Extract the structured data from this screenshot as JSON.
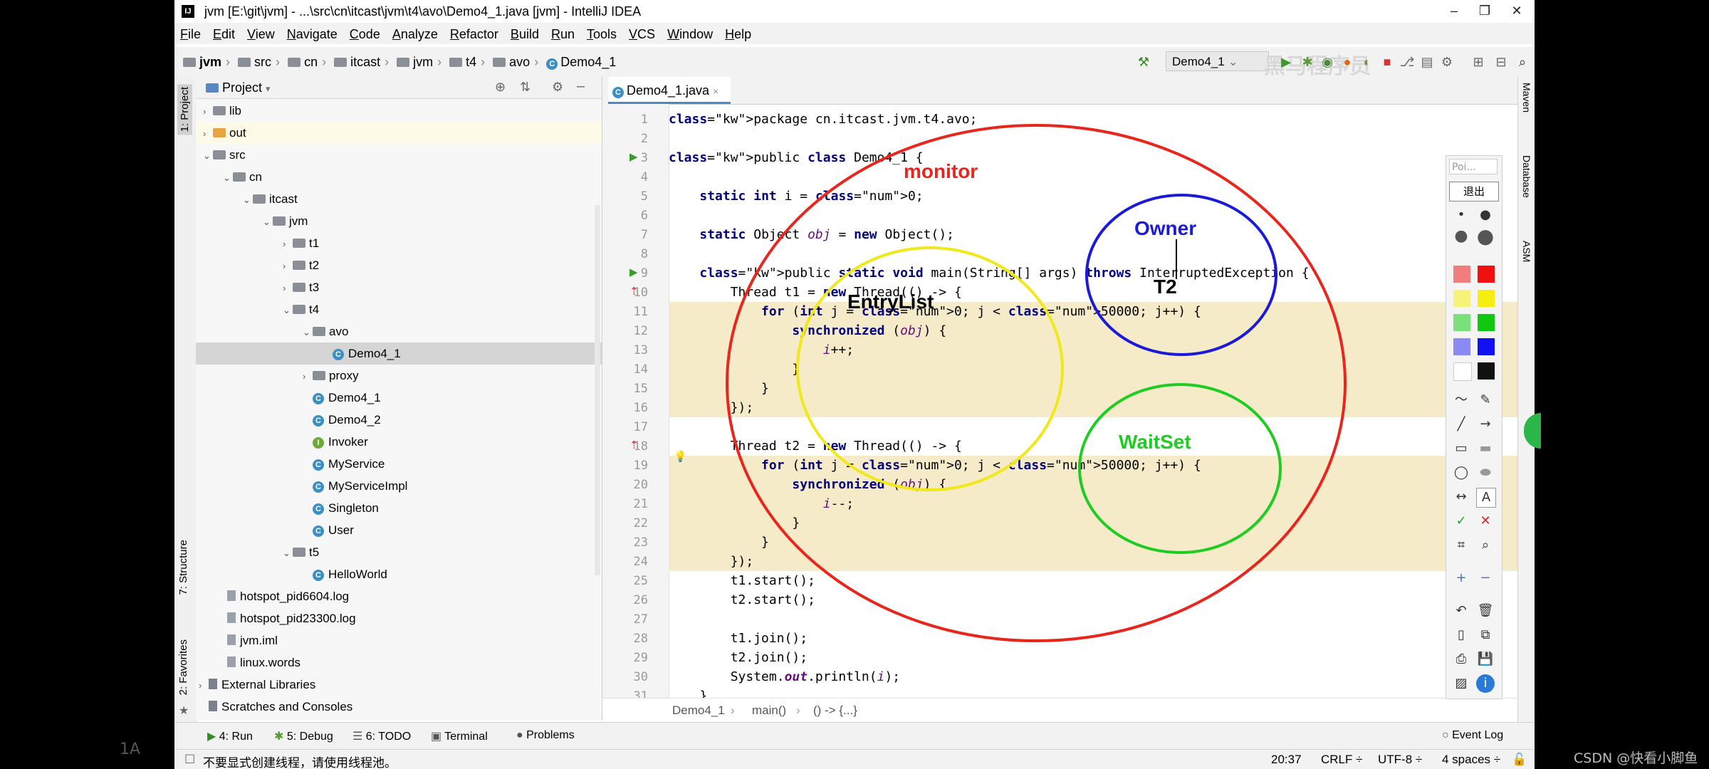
{
  "window": {
    "title": "jvm [E:\\git\\jvm] - ...\\src\\cn\\itcast\\jvm\\t4\\avo\\Demo4_1.java [jvm] - IntelliJ IDEA",
    "minimize": "–",
    "maximize": "❐",
    "close": "✕"
  },
  "menu": [
    "File",
    "Edit",
    "View",
    "Navigate",
    "Code",
    "Analyze",
    "Refactor",
    "Build",
    "Run",
    "Tools",
    "VCS",
    "Window",
    "Help"
  ],
  "breadcrumb": [
    "jvm",
    "src",
    "cn",
    "itcast",
    "jvm",
    "t4",
    "avo",
    "Demo4_1"
  ],
  "run_config": "Demo4_1",
  "toolbar_overlay_text": "黑马程序员",
  "left_strip": {
    "project": "1: Project",
    "structure": "7: Structure",
    "favorites": "2: Favorites"
  },
  "project_panel": {
    "title": "Project",
    "tree": [
      {
        "label": "lib",
        "type": "folder",
        "depth": 0,
        "arrow": "›"
      },
      {
        "label": "out",
        "type": "folder-orange",
        "depth": 0,
        "arrow": "›"
      },
      {
        "label": "src",
        "type": "folder",
        "depth": 0,
        "arrow": "⌄"
      },
      {
        "label": "cn",
        "type": "folder",
        "depth": 1,
        "arrow": "⌄"
      },
      {
        "label": "itcast",
        "type": "folder",
        "depth": 2,
        "arrow": "⌄"
      },
      {
        "label": "jvm",
        "type": "folder",
        "depth": 3,
        "arrow": "⌄"
      },
      {
        "label": "t1",
        "type": "folder",
        "depth": 4,
        "arrow": "›"
      },
      {
        "label": "t2",
        "type": "folder",
        "depth": 4,
        "arrow": "›"
      },
      {
        "label": "t3",
        "type": "folder",
        "depth": 4,
        "arrow": "›"
      },
      {
        "label": "t4",
        "type": "folder",
        "depth": 4,
        "arrow": "⌄"
      },
      {
        "label": "avo",
        "type": "folder",
        "depth": 5,
        "arrow": "⌄"
      },
      {
        "label": "Demo4_1",
        "type": "class",
        "depth": 6,
        "arrow": ""
      },
      {
        "label": "proxy",
        "type": "folder",
        "depth": 5,
        "arrow": "›"
      },
      {
        "label": "Demo4_1",
        "type": "class",
        "depth": 5,
        "arrow": ""
      },
      {
        "label": "Demo4_2",
        "type": "class",
        "depth": 5,
        "arrow": ""
      },
      {
        "label": "Invoker",
        "type": "interface",
        "depth": 5,
        "arrow": ""
      },
      {
        "label": "MyService",
        "type": "class",
        "depth": 5,
        "arrow": ""
      },
      {
        "label": "MyServiceImpl",
        "type": "class",
        "depth": 5,
        "arrow": ""
      },
      {
        "label": "Singleton",
        "type": "class",
        "depth": 5,
        "arrow": ""
      },
      {
        "label": "User",
        "type": "class",
        "depth": 5,
        "arrow": ""
      },
      {
        "label": "t5",
        "type": "folder",
        "depth": 4,
        "arrow": "⌄"
      },
      {
        "label": "HelloWorld",
        "type": "class",
        "depth": 5,
        "arrow": ""
      },
      {
        "label": "hotspot_pid6604.log",
        "type": "file",
        "depth": 0,
        "arrow": ""
      },
      {
        "label": "hotspot_pid23300.log",
        "type": "file",
        "depth": 0,
        "arrow": ""
      },
      {
        "label": "jvm.iml",
        "type": "file",
        "depth": 0,
        "arrow": ""
      },
      {
        "label": "linux.words",
        "type": "file",
        "depth": 0,
        "arrow": ""
      },
      {
        "label": "External Libraries",
        "type": "lib",
        "depth": -1,
        "arrow": "›"
      },
      {
        "label": "Scratches and Consoles",
        "type": "lib",
        "depth": -1,
        "arrow": ""
      }
    ]
  },
  "editor": {
    "tab": "Demo4_1.java",
    "lines": [
      {
        "n": "1",
        "t": "package cn.itcast.jvm.t4.avo;"
      },
      {
        "n": "2",
        "t": ""
      },
      {
        "n": "3",
        "t": "public class Demo4_1 {"
      },
      {
        "n": "4",
        "t": ""
      },
      {
        "n": "5",
        "t": "    static int i = 0;"
      },
      {
        "n": "6",
        "t": ""
      },
      {
        "n": "7",
        "t": "    static Object obj = new Object();"
      },
      {
        "n": "8",
        "t": ""
      },
      {
        "n": "9",
        "t": "    public static void main(String[] args) throws InterruptedException {"
      },
      {
        "n": "10",
        "t": "        Thread t1 = new Thread(() -> {"
      },
      {
        "n": "11",
        "t": "            for (int j = 0; j < 50000; j++) {"
      },
      {
        "n": "12",
        "t": "                synchronized (obj) {"
      },
      {
        "n": "13",
        "t": "                    i++;"
      },
      {
        "n": "14",
        "t": "                }"
      },
      {
        "n": "15",
        "t": "            }"
      },
      {
        "n": "16",
        "t": "        });"
      },
      {
        "n": "17",
        "t": ""
      },
      {
        "n": "18",
        "t": "        Thread t2 = new Thread(() -> {"
      },
      {
        "n": "19",
        "t": "            for (int j = 0; j < 50000; j++) {"
      },
      {
        "n": "20",
        "t": "                synchronized (obj) {"
      },
      {
        "n": "21",
        "t": "                    i--;"
      },
      {
        "n": "22",
        "t": "                }"
      },
      {
        "n": "23",
        "t": "            }"
      },
      {
        "n": "24",
        "t": "        });"
      },
      {
        "n": "25",
        "t": "        t1.start();"
      },
      {
        "n": "26",
        "t": "        t2.start();"
      },
      {
        "n": "27",
        "t": ""
      },
      {
        "n": "28",
        "t": "        t1.join();"
      },
      {
        "n": "29",
        "t": "        t2.join();"
      },
      {
        "n": "30",
        "t": "        System.out.println(i);"
      },
      {
        "n": "31",
        "t": "    }"
      }
    ],
    "breadcrumb": [
      "Demo4_1",
      "main()",
      "() -> {...}"
    ]
  },
  "annotations": {
    "monitor": "monitor",
    "owner": "Owner",
    "t2": "T2",
    "entrylist": "EntryList",
    "waitset": "WaitSet",
    "colors": {
      "monitor": "#e8261e",
      "owner": "#1a1ad8",
      "entrylist": "#f0e81a",
      "waitset": "#1fcc22"
    }
  },
  "palette": {
    "pointer": "Poi...",
    "exit": "退出"
  },
  "right_strip": [
    "Maven",
    "Database",
    "ASM"
  ],
  "bottom_tools": [
    "4: Run",
    "5: Debug",
    "6: TODO",
    "Terminal",
    "Problems",
    "Event Log"
  ],
  "status": {
    "message": "不要显式创建线程，请使用线程池。",
    "position": "20:37",
    "line_sep": "CRLF ÷",
    "encoding": "UTF-8 ÷",
    "indent": "4 spaces ÷"
  },
  "outside": {
    "watermark": "CSDN @快看小脚鱼",
    "left_text": "1A"
  }
}
